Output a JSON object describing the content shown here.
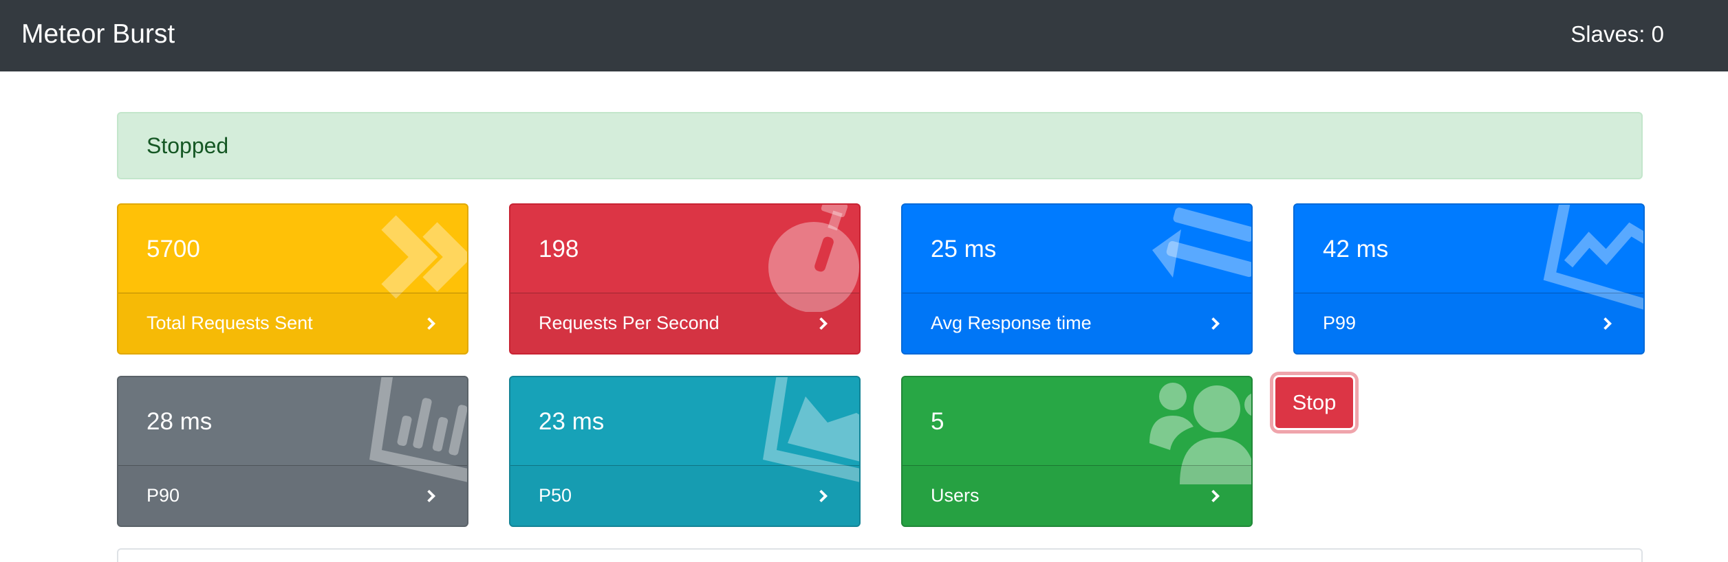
{
  "navbar": {
    "brand": "Meteor Burst",
    "slaves": "Slaves: 0"
  },
  "status": {
    "text": "Stopped"
  },
  "stats": [
    {
      "value": "5700",
      "label": "Total Requests Sent",
      "color": "#ffc107",
      "icon": "angle-double-right-icon"
    },
    {
      "value": "198",
      "label": "Requests Per Second",
      "color": "#dc3545",
      "icon": "stopwatch-icon"
    },
    {
      "value": "25 ms",
      "label": "Avg Response time",
      "color": "#007bff",
      "icon": "exchange-arrows-icon"
    },
    {
      "value": "42 ms",
      "label": "P99",
      "color": "#007bff",
      "icon": "line-chart-icon"
    },
    {
      "value": "28 ms",
      "label": "P90",
      "color": "#6c757d",
      "icon": "bar-chart-icon"
    },
    {
      "value": "23 ms",
      "label": "P50",
      "color": "#17a2b8",
      "icon": "area-chart-icon"
    },
    {
      "value": "5",
      "label": "Users",
      "color": "#28a745",
      "icon": "users-icon"
    }
  ],
  "actions": {
    "stop_label": "Stop",
    "stop_color": "#dc3545"
  }
}
